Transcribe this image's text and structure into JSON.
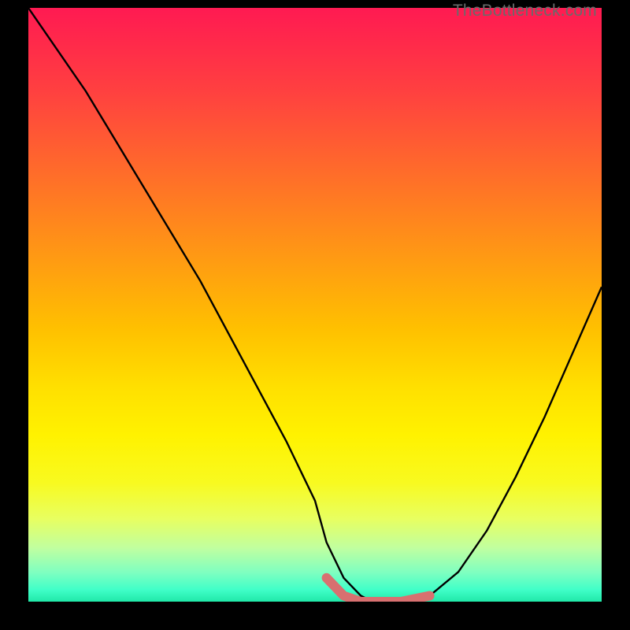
{
  "watermark": "TheBottleneck.com",
  "chart_data": {
    "type": "line",
    "title": "",
    "xlabel": "",
    "ylabel": "",
    "xlim": [
      0,
      100
    ],
    "ylim": [
      0,
      100
    ],
    "grid": false,
    "legend": false,
    "series": [
      {
        "name": "curve",
        "color": "#000000",
        "x": [
          0,
          5,
          10,
          15,
          20,
          25,
          30,
          35,
          40,
          45,
          50,
          52,
          55,
          58,
          60,
          62,
          65,
          70,
          75,
          80,
          85,
          90,
          95,
          100
        ],
        "y": [
          100,
          93,
          86,
          78,
          70,
          62,
          54,
          45,
          36,
          27,
          17,
          10,
          4,
          1,
          0,
          0,
          0,
          1,
          5,
          12,
          21,
          31,
          42,
          53
        ]
      },
      {
        "name": "bottom-accent",
        "color": "#d87070",
        "x": [
          52,
          55,
          58,
          60,
          62,
          65,
          70
        ],
        "y": [
          4,
          1,
          0,
          0,
          0,
          0,
          1
        ]
      }
    ],
    "gradient_zones": [
      {
        "value": 100,
        "color": "#ff1a52"
      },
      {
        "value": 50,
        "color": "#ffc000"
      },
      {
        "value": 10,
        "color": "#f0ff60"
      },
      {
        "value": 0,
        "color": "#20e8a8"
      }
    ]
  }
}
